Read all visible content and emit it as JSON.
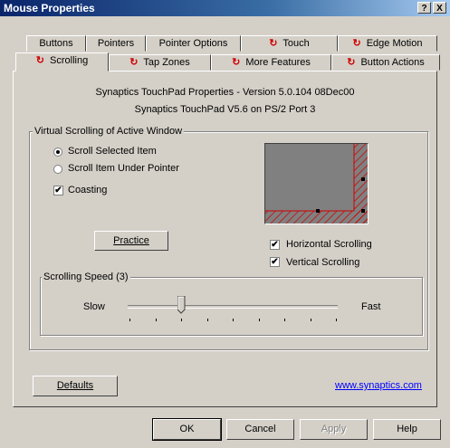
{
  "window": {
    "title": "Mouse Properties",
    "help_btn": "?",
    "close_btn": "X"
  },
  "tabs_row1": [
    {
      "label": "Buttons",
      "icon": ""
    },
    {
      "label": "Pointers",
      "icon": ""
    },
    {
      "label": "Pointer Options",
      "icon": ""
    },
    {
      "label": "Touch",
      "icon": "touchpad-icon"
    },
    {
      "label": "Edge Motion",
      "icon": "touchpad-icon"
    }
  ],
  "tabs_row2": [
    {
      "label": "Scrolling",
      "icon": "touchpad-icon"
    },
    {
      "label": "Tap Zones",
      "icon": "touchpad-icon"
    },
    {
      "label": "More Features",
      "icon": "touchpad-icon"
    },
    {
      "label": "Button Actions",
      "icon": "touchpad-icon"
    }
  ],
  "info": {
    "line1": "Synaptics TouchPad Properties - Version 5.0.104 08Dec00",
    "line2": "Synaptics TouchPad V5.6 on PS/2 Port 3"
  },
  "virtual_group": {
    "legend": "Virtual Scrolling of Active Window",
    "radio_selected": "Scroll Selected Item",
    "radio_pointer": "Scroll Item Under Pointer",
    "selected": "Scroll Selected Item",
    "coasting": {
      "label": "Coasting",
      "checked": true
    },
    "practice": "Practice",
    "horizontal": {
      "label": "Horizontal Scrolling",
      "checked": true
    },
    "vertical": {
      "label": "Vertical Scrolling",
      "checked": true
    }
  },
  "speed_group": {
    "legend": "Scrolling Speed (3)",
    "slow": "Slow",
    "fast": "Fast",
    "level": 3,
    "ticks": 9
  },
  "defaults_btn": "Defaults",
  "link": "www.synaptics.com",
  "footer": {
    "ok": "OK",
    "cancel": "Cancel",
    "apply": "Apply",
    "help": "Help"
  },
  "colors": {
    "accent_red": "#d00000",
    "link_blue": "#0000ff"
  }
}
